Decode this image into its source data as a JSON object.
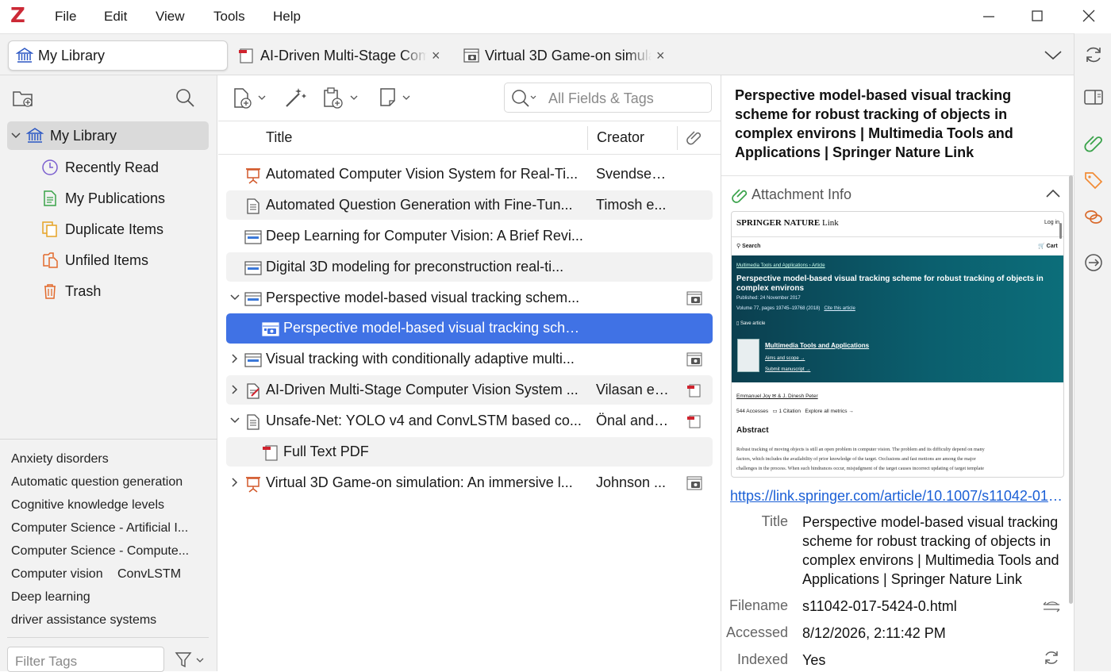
{
  "menubar": {
    "logo": "Z",
    "menus": [
      "File",
      "Edit",
      "View",
      "Tools",
      "Help"
    ]
  },
  "tabs": [
    {
      "label": "My Library",
      "active": true
    },
    {
      "label": "AI-Driven Multi-Stage Com",
      "close": "×"
    },
    {
      "label": "Virtual 3D Game-on simula",
      "close": "×"
    }
  ],
  "collections": {
    "root": "My Library",
    "items": [
      "Recently Read",
      "My Publications",
      "Duplicate Items",
      "Unfiled Items",
      "Trash"
    ]
  },
  "tags": [
    "Anxiety disorders",
    "Automatic question generation",
    "Cognitive knowledge levels",
    "Computer Science - Artificial I...",
    "Computer Science - Compute...",
    "Computer vision",
    "ConvLSTM",
    "Deep learning",
    "driver assistance systems"
  ],
  "tag_filter": {
    "placeholder": "Filter Tags"
  },
  "search": {
    "placeholder": "All Fields & Tags"
  },
  "columns": {
    "title": "Title",
    "creator": "Creator"
  },
  "items": [
    {
      "title": "Automated Computer Vision System for Real-Ti...",
      "creator": "Svendsen...",
      "icon": "presentation-icon"
    },
    {
      "title": "Automated Question Generation with Fine-Tun...",
      "creator": "Timosh e...",
      "icon": "document-icon"
    },
    {
      "title": "Deep Learning for Computer Vision: A Brief Revi...",
      "creator": "",
      "icon": "webpage-icon"
    },
    {
      "title": "Digital 3D modeling for preconstruction real-ti...",
      "creator": "",
      "icon": "webpage-icon"
    },
    {
      "title": "Perspective model-based visual tracking schem...",
      "creator": "",
      "icon": "webpage-icon",
      "expanded": true
    },
    {
      "title": "Perspective model-based visual tracking sche...",
      "creator": "",
      "icon": "snapshot-icon",
      "child": true,
      "selected": true
    },
    {
      "title": "Visual tracking with conditionally adaptive multi...",
      "creator": "",
      "icon": "webpage-icon"
    },
    {
      "title": "AI-Driven Multi-Stage Computer Vision System ...",
      "creator": "Vilasan et...",
      "icon": "preprint-icon"
    },
    {
      "title": "Unsafe-Net: YOLO v4 and ConvLSTM based co...",
      "creator": "Önal and ...",
      "icon": "document-icon",
      "expanded": true
    },
    {
      "title": "Full Text PDF",
      "creator": "",
      "icon": "pdf-icon",
      "child": true
    },
    {
      "title": "Virtual 3D Game-on simulation: An immersive l...",
      "creator": "Johnson ...",
      "icon": "presentation-icon"
    }
  ],
  "item_pane": {
    "title": "Perspective model-based visual tracking scheme for robust tracking of objects in complex environs | Multimedia Tools and Applications | Springer Nature Link",
    "section": "Attachment Info",
    "url": "https://link.springer.com/article/10.1007/s11042-017-5424-0",
    "fields": {
      "title_label": "Title",
      "title_value": "Perspective model-based visual tracking scheme for robust tracking of objects in complex environs | Multimedia Tools and Applications | Springer Nature Link",
      "filename_label": "Filename",
      "filename_value": "s11042-017-5424-0.html",
      "accessed_label": "Accessed",
      "accessed_value": "8/12/2026, 2:11:42 PM",
      "indexed_label": "Indexed",
      "indexed_value": "Yes"
    }
  },
  "preview": {
    "brand": "SPRINGER NATURE",
    "brand_link": "Link",
    "login": "Log in",
    "search": "Search",
    "cart": "Cart",
    "breadcrumb": "Multimedia Tools and Applications  ›  Article",
    "article_title": "Perspective model-based visual tracking scheme for robust tracking of objects in complex environs",
    "published": "Published: 24 November 2017",
    "volume": "Volume 77, pages 19745–19768 (2018)",
    "cite": "Cite this article",
    "save": "Save article",
    "journal": "Multimedia Tools and Applications",
    "aims": "Aims and scope →",
    "submit": "Submit manuscript →",
    "authors": "Emmanuel Joy ✉ & J. Dinesh Peter",
    "accesses": "544  Accesses",
    "citations": "1  Citation",
    "metrics": "Explore all metrics  →",
    "abstract_heading": "Abstract",
    "abstract_lines": [
      "Robust tracking of moving objects is still an open problem in computer vision. The problem and its difficulty depend on many",
      "factors, which includes the availability of prior knowledge of the target. Occlusions and fast motions are among the major",
      "challenges in the process. When such hindrances occur, misjudgment of the target causes incorrect updating of target template"
    ]
  },
  "colors": {
    "accent": "#4072e5",
    "brand_red": "#cc2936",
    "teal": "#0b5f6e"
  }
}
